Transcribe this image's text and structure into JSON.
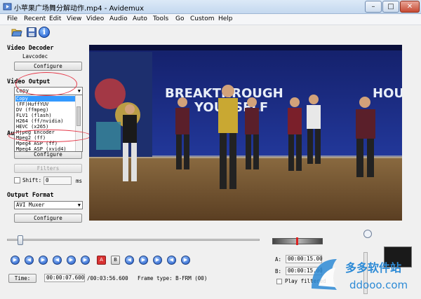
{
  "window": {
    "title": "小苹果广场舞分解动作.mp4 - Avidemux",
    "minimize": "–",
    "maximize": "□",
    "close": "✕"
  },
  "menu": [
    "File",
    "Recent",
    "Edit",
    "View",
    "Video",
    "Audio",
    "Auto",
    "Tools",
    "Go",
    "Custom",
    "Help"
  ],
  "toolbar": {
    "icons": [
      "open-folder-icon",
      "save-disk-icon",
      "info-icon"
    ],
    "info_glyph": "i"
  },
  "video_decoder": {
    "label": "Video Decoder",
    "codec": "Lavcodec",
    "configure": "Configure"
  },
  "video_output": {
    "label": "Video Output",
    "selected": "Copy",
    "options": [
      "Copy",
      "(FF)HuffYUV",
      "DV (ffmpeg)",
      "FLV1 (flash)",
      "H264 (ff/nvidia)",
      "HEVC (x265)",
      "Mjpeg Encoder",
      "Mpeg2 (ff)",
      "Mpeg4 ASP (ff)",
      "Mpeg4 ASP (xvid4)"
    ],
    "highlighted_index": 0
  },
  "audio_output": {
    "label_fragment": "Au",
    "configure": "Configure",
    "filters": "Filters",
    "shift_label": "Shift:",
    "shift_value": "0",
    "shift_unit": "ms"
  },
  "output_format": {
    "label": "Output Format",
    "selected": "AVI Muxer",
    "configure": "Configure"
  },
  "video_text": {
    "banner_left": "BREAKTHROUGH",
    "banner_right": "YOURSELF",
    "banner_far": "HOU"
  },
  "controls": {
    "glyphs": [
      "▶",
      "◀",
      "▶",
      "◀",
      "▶",
      "A",
      "B",
      "◀",
      "▶",
      "▶",
      "◀",
      "▶",
      "▶"
    ],
    "time_button": "Time:",
    "current_time": "00:00:07.600",
    "total_time": "/00:03:56.600",
    "frame_type": "Frame type: B-FRM (00)",
    "a_label": "A:",
    "a_value": "00:00:15.00",
    "b_label": "B:",
    "b_value": "00:00:15.00",
    "play_filtered": "Play filtered"
  },
  "watermark": {
    "cn": "多多软件站",
    "en": "ddooo.com"
  },
  "colors": {
    "accent": "#3399ff",
    "annotation": "#e53a4a",
    "title_bar": "#c4d8ef",
    "video_bg": "#1b2a7a"
  }
}
